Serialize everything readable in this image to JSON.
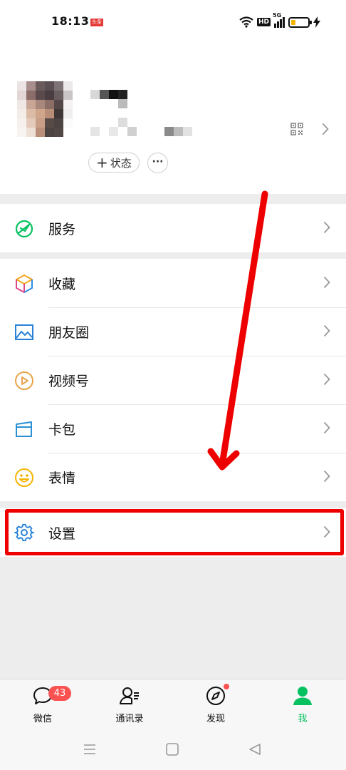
{
  "status_bar": {
    "time": "18:13",
    "notif_label": "头条",
    "hd": "HD",
    "network": "5G",
    "battery_level": 0.25,
    "battery_color": "#f5b400"
  },
  "profile": {
    "status_button": "状态",
    "more_button": "···",
    "qr_icon": "qr-code-icon"
  },
  "menu": {
    "services": {
      "label": "服务",
      "icon": "services-icon",
      "color": "#07c160"
    },
    "items": [
      {
        "label": "收藏",
        "icon": "favorites-cube-icon"
      },
      {
        "label": "朋友圈",
        "icon": "moments-picture-icon",
        "color": "#2782d7"
      },
      {
        "label": "视频号",
        "icon": "channels-play-icon",
        "color": "#e8a44b"
      },
      {
        "label": "卡包",
        "icon": "card-wallet-icon",
        "color": "#2b8fd4"
      },
      {
        "label": "表情",
        "icon": "sticker-smile-icon",
        "color": "#f5b400"
      }
    ],
    "settings": {
      "label": "设置",
      "icon": "gear-icon",
      "color": "#2782d7"
    }
  },
  "tabbar": {
    "tabs": [
      {
        "label": "微信",
        "icon": "chat-bubble-icon",
        "badge": "43"
      },
      {
        "label": "通讯录",
        "icon": "contacts-icon"
      },
      {
        "label": "发现",
        "icon": "compass-icon",
        "dot": true
      },
      {
        "label": "我",
        "icon": "person-icon",
        "active": true
      }
    ],
    "active_color": "#07c160",
    "badge_color": "#fa5151"
  },
  "annotation": {
    "color": "#ee0000"
  }
}
